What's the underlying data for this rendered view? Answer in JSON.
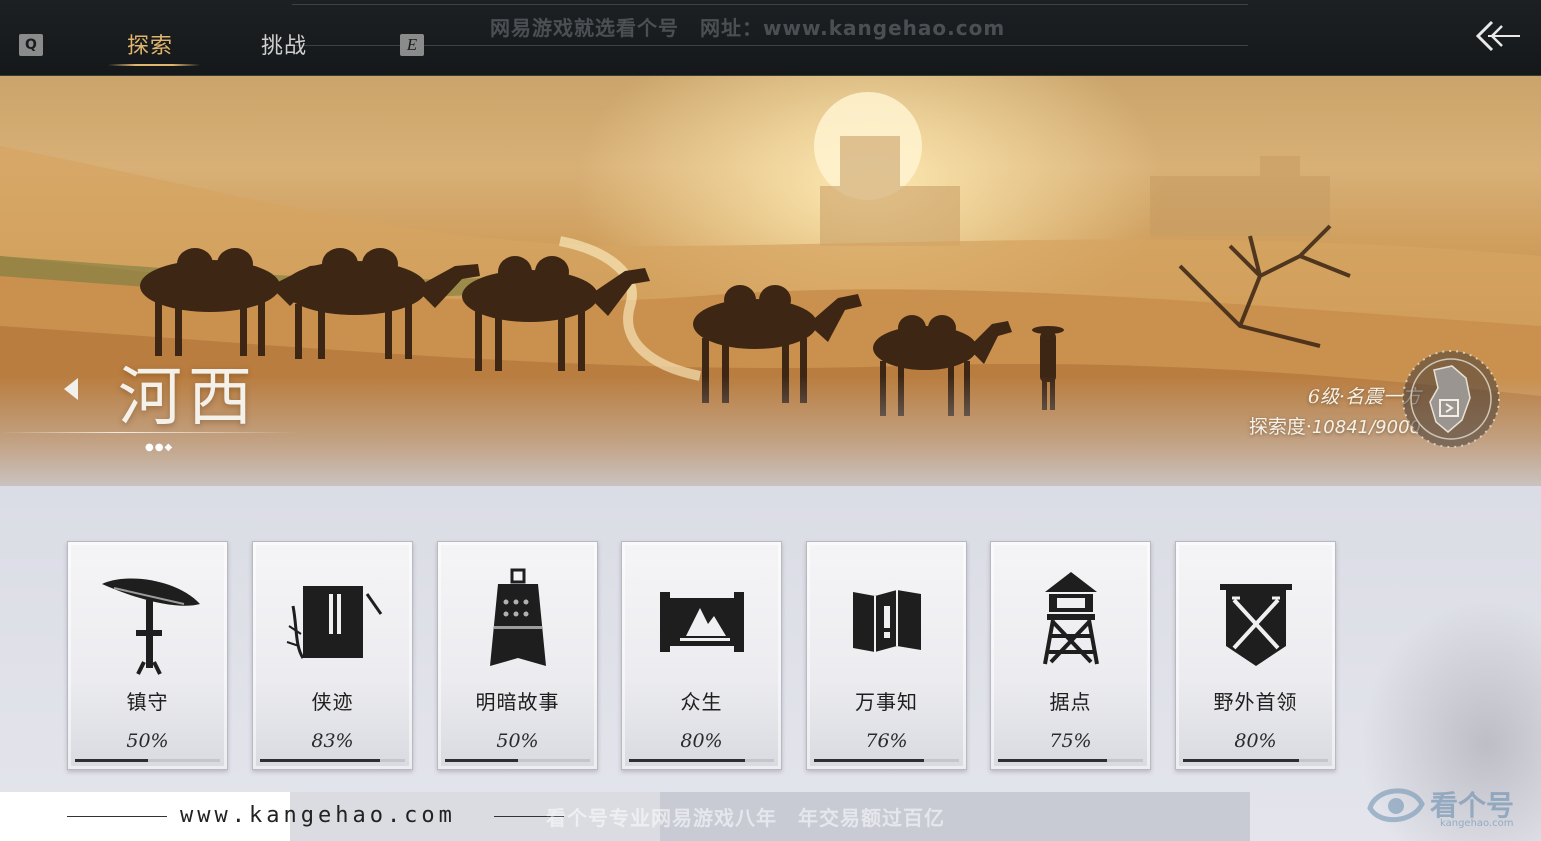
{
  "topbar": {
    "key_left": "Q",
    "key_right": "E",
    "tabs": [
      {
        "label": "探索",
        "active": true
      },
      {
        "label": "挑战",
        "active": false
      }
    ],
    "watermark": "网易游戏就选看个号　网址：www.kangehao.com"
  },
  "banner": {
    "region_name": "河西",
    "pager_dots": "●●◆",
    "level": "6级·名震一方",
    "explore_label": "探索度·",
    "explore_value": "10841/9000"
  },
  "cards": [
    {
      "label": "镇守",
      "percent_text": "50%",
      "progress": 0.5,
      "icon": "bamboo-hat-icon"
    },
    {
      "label": "侠迹",
      "percent_text": "83%",
      "progress": 0.83,
      "icon": "book-icon"
    },
    {
      "label": "明暗故事",
      "percent_text": "50%",
      "progress": 0.5,
      "icon": "bell-icon"
    },
    {
      "label": "众生",
      "percent_text": "80%",
      "progress": 0.8,
      "icon": "scroll-icon"
    },
    {
      "label": "万事知",
      "percent_text": "76%",
      "progress": 0.76,
      "icon": "map-icon"
    },
    {
      "label": "据点",
      "percent_text": "75%",
      "progress": 0.75,
      "icon": "watchtower-icon"
    },
    {
      "label": "野外首领",
      "percent_text": "80%",
      "progress": 0.8,
      "icon": "crossed-swords-banner-icon"
    }
  ],
  "footer": {
    "site_url": "www.kangehao.com",
    "watermark": "看个号专业网易游戏八年　年交易额过百亿",
    "logo_text": "看个号",
    "logo_sub": "kangehao.com"
  },
  "colors": {
    "accent_gold": "#e0b56e",
    "topbar_bg": "#1b1e20",
    "ink": "#1e1e1e"
  }
}
